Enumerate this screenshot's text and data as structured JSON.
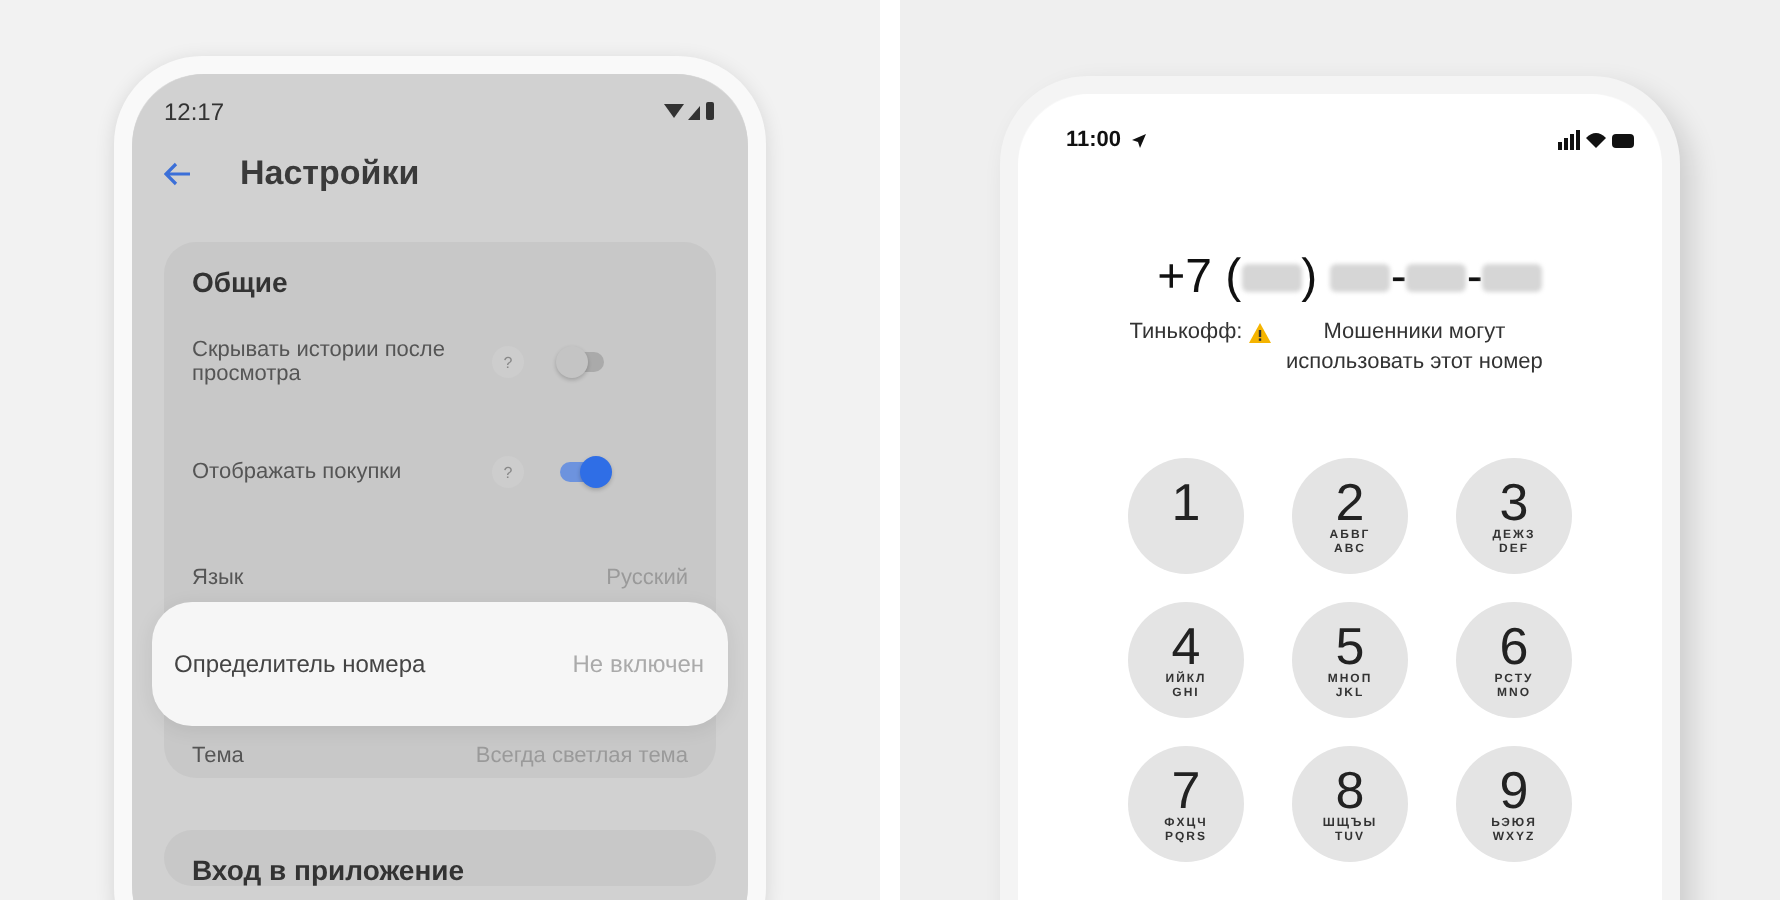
{
  "settings_screen": {
    "status_bar": {
      "time": "12:17"
    },
    "title": "Настройки",
    "sections": [
      {
        "title": "Общие",
        "rows": [
          {
            "kind": "toggle",
            "label": "Скрывать истории после просмотра",
            "help": "?",
            "on": false
          },
          {
            "kind": "toggle",
            "label": "Отображать покупки",
            "help": "?",
            "on": true
          },
          {
            "kind": "value",
            "label": "Язык",
            "value": "Русский",
            "highlighted": false
          },
          {
            "kind": "value",
            "label": "Определитель номера",
            "value": "Не включен",
            "highlighted": true
          },
          {
            "kind": "value",
            "label": "Тема",
            "value": "Всегда светлая тема",
            "highlighted": false
          }
        ]
      },
      {
        "title": "Вход в приложение"
      }
    ]
  },
  "dialer_screen": {
    "status_bar": {
      "time": "11:00"
    },
    "number": [
      {
        "kind": "text",
        "text": "+7 ("
      },
      {
        "kind": "blur"
      },
      {
        "kind": "text",
        "text": ") "
      },
      {
        "kind": "blur"
      },
      {
        "kind": "text",
        "text": "-"
      },
      {
        "kind": "blur"
      },
      {
        "kind": "text",
        "text": "-"
      },
      {
        "kind": "blur"
      }
    ],
    "caller": "Тинькофф:",
    "warning": "Мошенники могут использовать этот номер",
    "keys": [
      {
        "digit": "1"
      },
      {
        "digit": "2",
        "letters": [
          "АБВГ",
          "ABC"
        ]
      },
      {
        "digit": "3",
        "letters": [
          "ДЕЖЗ",
          "DEF"
        ]
      },
      {
        "digit": "4",
        "letters": [
          "ИЙКЛ",
          "GHI"
        ]
      },
      {
        "digit": "5",
        "letters": [
          "МНОП",
          "JKL"
        ]
      },
      {
        "digit": "6",
        "letters": [
          "РСТУ",
          "MNO"
        ]
      },
      {
        "digit": "7",
        "letters": [
          "ФХЦЧ",
          "PQRS"
        ]
      },
      {
        "digit": "8",
        "letters": [
          "ШЩЪЫ",
          "TUV"
        ]
      },
      {
        "digit": "9",
        "letters": [
          "ЬЭЮЯ",
          "WXYZ"
        ]
      }
    ]
  }
}
